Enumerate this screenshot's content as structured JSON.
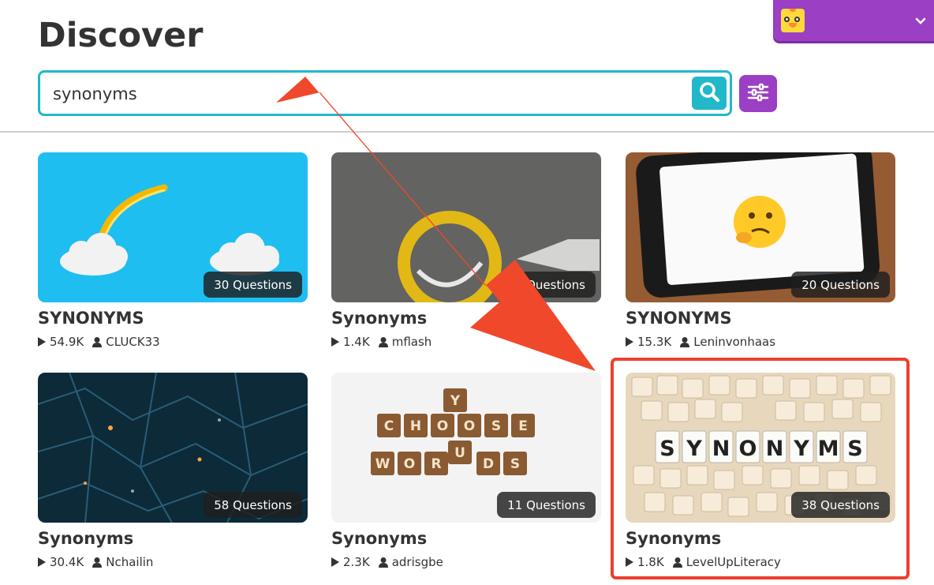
{
  "header": {
    "title": "Discover"
  },
  "search": {
    "value": "synonyms"
  },
  "colors": {
    "accent": "#22b8c9",
    "purple": "#9b3fc4",
    "highlight": "#ee3f2e"
  },
  "cards": [
    {
      "title": "SYNONYMS",
      "questions": "30 Questions",
      "plays": "54.9K",
      "author": "CLUCK33"
    },
    {
      "title": "Synonyms",
      "questions": "... Questions",
      "plays": "1.4K",
      "author": "mflash"
    },
    {
      "title": "SYNONYMS",
      "questions": "20 Questions",
      "plays": "15.3K",
      "author": "Leninvonhaas"
    },
    {
      "title": "Synonyms",
      "questions": "58 Questions",
      "plays": "30.4K",
      "author": "Nchailin"
    },
    {
      "title": "Synonyms",
      "questions": "11 Questions",
      "plays": "2.3K",
      "author": "adrisgbe"
    },
    {
      "title": "Synonyms",
      "questions": "38 Questions",
      "plays": "1.8K",
      "author": "LevelUpLiteracy"
    }
  ],
  "images": {
    "word_tiles": [
      "C",
      "H",
      "O",
      "O",
      "S",
      "E",
      "Y",
      "U",
      "W",
      "O",
      "R",
      "D",
      "S"
    ],
    "synonyms_tiles": [
      "S",
      "Y",
      "N",
      "O",
      "N",
      "Y",
      "M",
      "S"
    ]
  }
}
